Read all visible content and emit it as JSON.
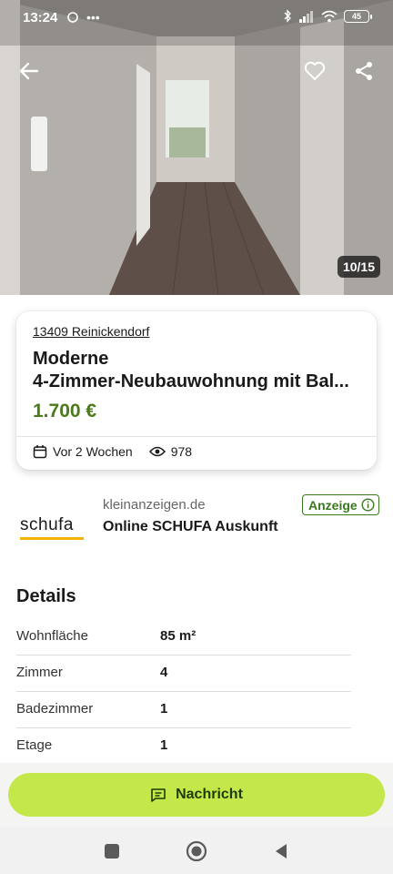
{
  "status_bar": {
    "time": "13:24",
    "battery": "45"
  },
  "gallery": {
    "counter": "10/15"
  },
  "listing": {
    "location": "13409 Reinickendorf",
    "title_line1": "Moderne",
    "title_line2": "4-Zimmer-Neubauwohnung mit Bal...",
    "price": "1.700 €",
    "posted": "Vor 2 Wochen",
    "views": "978"
  },
  "ad": {
    "logo_text": "schufa",
    "domain": "kleinanzeigen.de",
    "title": "Online SCHUFA Auskunft",
    "badge": "Anzeige"
  },
  "details": {
    "heading": "Details",
    "rows": [
      {
        "label": "Wohnfläche",
        "value": "85 m²"
      },
      {
        "label": "Zimmer",
        "value": "4"
      },
      {
        "label": "Badezimmer",
        "value": "1"
      },
      {
        "label": "Etage",
        "value": "1"
      }
    ]
  },
  "cta": {
    "label": "Nachricht"
  },
  "colors": {
    "price": "#4a7a1a",
    "cta_bg": "#c4e84a",
    "ad_badge": "#3a7a1e",
    "schufa_bar": "#f5b400"
  },
  "icons": [
    "back-arrow-icon",
    "heart-icon",
    "share-icon",
    "calendar-icon",
    "eye-icon",
    "info-icon",
    "message-icon",
    "nav-recents-icon",
    "nav-home-icon",
    "nav-back-icon"
  ]
}
